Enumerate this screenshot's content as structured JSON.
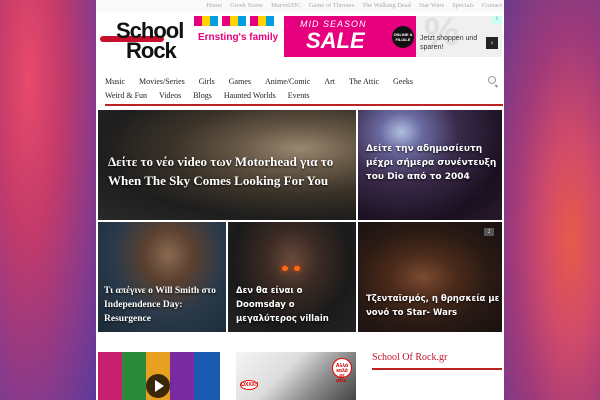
{
  "top_menu": [
    "Home",
    "Greek Scene",
    "Marvel/DC",
    "Game of Thrones",
    "The Walking Dead",
    "Star Wars",
    "Specials",
    "Contact"
  ],
  "logo": {
    "line1": "School",
    "line2": "Rock"
  },
  "ad": {
    "brand": "Ernsting's family",
    "headline": "MID SEASON",
    "sale": "SALE",
    "badge": "ONLINE & FILIALE",
    "percent": "%",
    "cta": "Jetzt shoppen und sparen!",
    "info_icon": "i"
  },
  "main_nav": {
    "row1": [
      "Music",
      "Movies/Series",
      "Girls",
      "Games",
      "Anime/Comic",
      "Art",
      "The Attic",
      "Geeks"
    ],
    "row2": [
      "Weird & Fun",
      "Videos",
      "Blogs",
      "Haunted Worlds",
      "Events"
    ]
  },
  "articles": [
    {
      "title": "Δείτε το νέο video των Motorhead για το When The Sky Comes Looking For You"
    },
    {
      "title": "Δείτε την αδημοσίευτη μέχρι σήμερα συνέντευξη του Dio από το 2004"
    },
    {
      "title": "Τι απέγινε ο Will Smith στο Independence Day: Resurgence"
    },
    {
      "title": "Δεν θα είναι ο Doomsday ο μεγαλύτερος villain"
    },
    {
      "title": "Τζενταϊσμός, η θρησκεία με νονό το Star- Wars",
      "badge": "2"
    }
  ],
  "comic": {
    "bubble1": "ΩΧΧΧ!!",
    "bubble2": "Αλλά καλά ρε φίλε;"
  },
  "sidebar": {
    "title": "School Of Rock.gr"
  },
  "colors": {
    "accent": "#b22222",
    "brand_red": "#c0102a",
    "ad_pink": "#e6007e"
  }
}
